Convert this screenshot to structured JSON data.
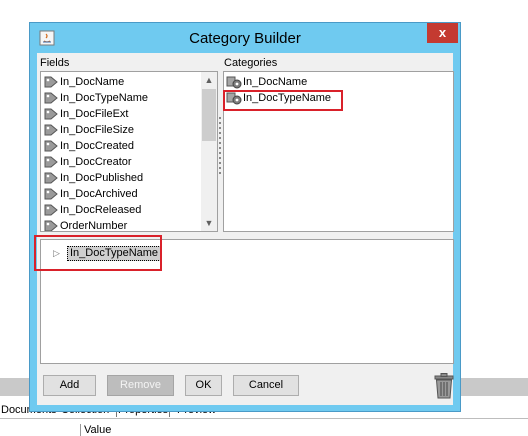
{
  "dialog": {
    "title": "Category Builder",
    "close_label": "x"
  },
  "fields": {
    "label": "Fields",
    "items": [
      "In_DocName",
      "In_DocTypeName",
      "In_DocFileExt",
      "In_DocFileSize",
      "In_DocCreated",
      "In_DocCreator",
      "In_DocPublished",
      "In_DocArchived",
      "In_DocReleased",
      "OrderNumber"
    ]
  },
  "categories": {
    "label": "Categories",
    "items": [
      "In_DocName",
      "In_DocTypeName"
    ]
  },
  "tree": {
    "node_label": "In_DocTypeName"
  },
  "buttons": {
    "add": "Add",
    "remove": "Remove",
    "ok": "OK",
    "cancel": "Cancel"
  },
  "background": {
    "tabs": [
      "Documents",
      "Collection",
      "Properties",
      "Preview"
    ],
    "column_header": "Value"
  },
  "colors": {
    "titlebar": "#6fcaf0",
    "close": "#c43a31",
    "highlight": "#d9212a"
  }
}
